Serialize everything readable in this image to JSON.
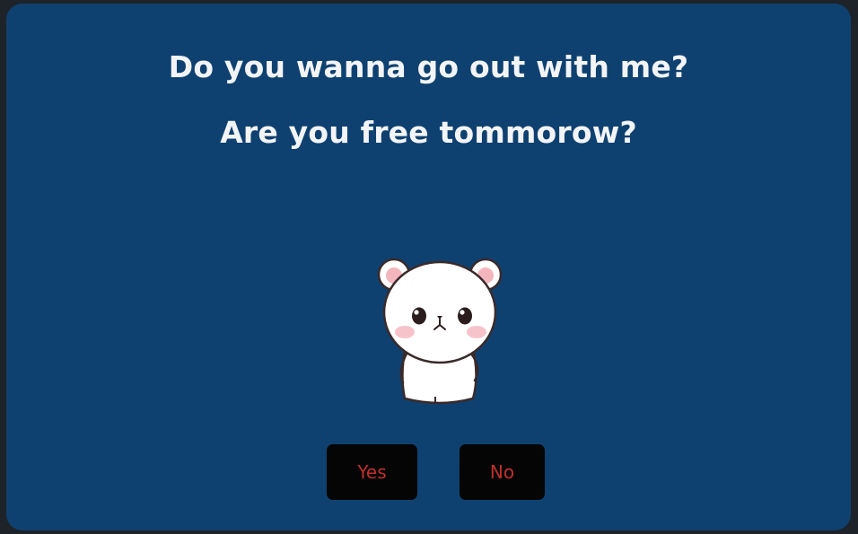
{
  "dialog": {
    "question_1": "Do you wanna go out with me?",
    "question_2": "Are you free tommorow?",
    "image": {
      "icon": "white-bear-sticker-icon"
    },
    "buttons": {
      "yes_label": "Yes",
      "no_label": "No"
    }
  },
  "colors": {
    "background": "#0f4170",
    "frame": "#1e2329",
    "text": "#f2f4f6",
    "button_bg": "#050506",
    "button_text": "#c0302c"
  }
}
